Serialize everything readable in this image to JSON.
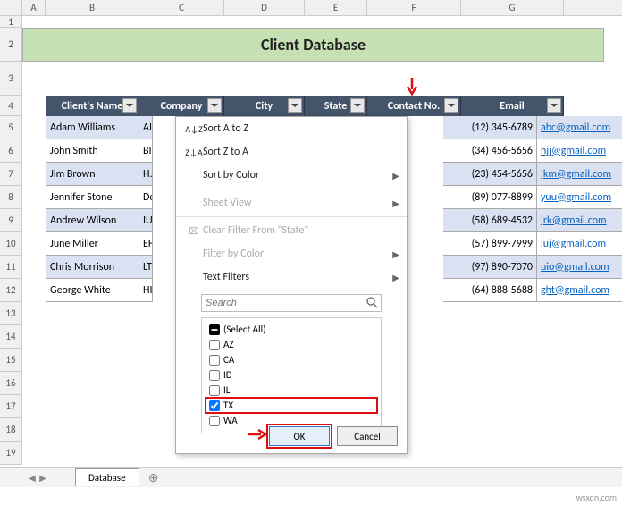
{
  "columns": [
    "A",
    "B",
    "C",
    "D",
    "E",
    "F",
    "G"
  ],
  "title": "Client Database",
  "headers": {
    "name": "Client's Name",
    "company": "Company",
    "city": "City",
    "state": "State",
    "contact": "Contact No.",
    "email": "Email"
  },
  "rows": [
    {
      "name": "Adam Williams",
      "company": "AI",
      "contact": "(12) 345-6789",
      "email": "abc@gmail.com"
    },
    {
      "name": "John Smith",
      "company": "BI",
      "contact": "(34) 456-5656",
      "email": "hjj@gmail.com"
    },
    {
      "name": "Jim Brown",
      "company": "H.",
      "contact": "(23) 454-5656",
      "email": "jkm@gmail.com"
    },
    {
      "name": "Jennifer Stone",
      "company": "Do",
      "contact": "(89) 077-8899",
      "email": "yuu@gmail.com"
    },
    {
      "name": "Andrew Wilson",
      "company": "IU",
      "contact": "(58) 689-4532",
      "email": "jrk@gmail.com"
    },
    {
      "name": "June Miller",
      "company": "EF",
      "contact": "(57) 899-7999",
      "email": "iuj@gmail.com"
    },
    {
      "name": "Chris Morrison",
      "company": "LT",
      "contact": "(97) 890-7070",
      "email": "uio@gmail.com"
    },
    {
      "name": "George White",
      "company": "HI",
      "contact": "(64) 888-5688",
      "email": "ght@gmail.com"
    }
  ],
  "filter": {
    "sortAZ": "Sort A to Z",
    "sortZA": "Sort Z to A",
    "sortColor": "Sort by Color",
    "sheetView": "Sheet View",
    "clear": "Clear Filter From \"State\"",
    "filterColor": "Filter by Color",
    "textFilters": "Text Filters",
    "searchPlaceholder": "Search",
    "options": {
      "selectAll": "(Select All)",
      "items": [
        "AZ",
        "CA",
        "ID",
        "IL",
        "TX",
        "WA"
      ]
    },
    "ok": "OK",
    "cancel": "Cancel"
  },
  "sheet": {
    "active": "Database"
  },
  "watermark": "wsxdn.com"
}
